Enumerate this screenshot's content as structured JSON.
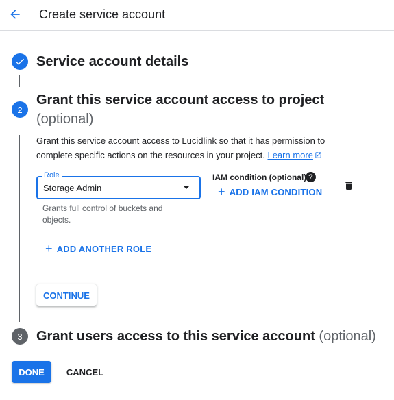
{
  "header": {
    "title": "Create service account",
    "back_icon": "arrow-back-icon"
  },
  "steps": [
    {
      "marker": "check",
      "title": "Service account details"
    },
    {
      "marker": "2",
      "title": "Grant this service account access to project",
      "optional": "(optional)"
    },
    {
      "marker": "3",
      "title": "Grant users access to this service account",
      "optional": "(optional)"
    }
  ],
  "grant": {
    "description": "Grant this service account access to Lucidlink so that it has permission to complete specific actions on the resources in your project.",
    "learn_more": "Learn more",
    "role_label": "Role",
    "role_value": "Storage Admin",
    "role_hint": "Grants full control of buckets and objects.",
    "iam_condition_label": "IAM condition (optional)",
    "add_iam_condition": "ADD IAM CONDITION",
    "add_another_role": "ADD ANOTHER ROLE",
    "continue": "CONTINUE"
  },
  "footer": {
    "done": "DONE",
    "cancel": "CANCEL"
  },
  "colors": {
    "accent": "#1a73e8",
    "inactive_step": "#5f6368"
  }
}
